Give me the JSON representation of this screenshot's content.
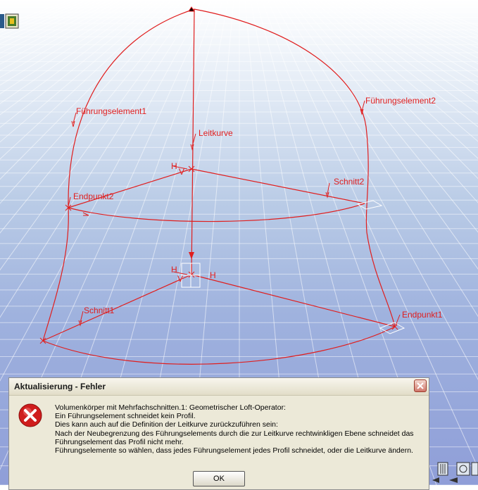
{
  "viewport": {
    "labels": {
      "fuehrung1": "Führungselement1",
      "fuehrung2": "Führungselement2",
      "leitkurve": "Leitkurve",
      "schnitt1": "Schnitt1",
      "schnitt2": "Schnitt2",
      "endpunkt1": "Endpunkt1",
      "endpunkt2": "Endpunkt2",
      "h_top": "H",
      "v_top": "V",
      "h_mid_left": "H",
      "h_mid_right": "H",
      "v_mid": "V"
    },
    "geometry_color": "#e01e1e"
  },
  "dialog": {
    "title": "Aktualisierung - Fehler",
    "icon": "error-icon",
    "lines": [
      "Volumenkörper mit Mehrfachschnitten.1: Geometrischer Loft-Operator:",
      "Ein Führungselement schneidet kein Profil.",
      "Dies kann auch auf die Definition der Leitkurve zurückzuführen sein:",
      "Nach der Neubegrenzung des Führungselements durch die zur Leitkurve rechtwinkligen Ebene schneidet das",
      "Führungselement das Profil nicht mehr.",
      "Führungselemente so wählen, dass jedes Führungselement jedes Profil schneidet, oder die Leitkurve ändern."
    ],
    "ok_label": "OK",
    "close_icon": "close-icon"
  }
}
